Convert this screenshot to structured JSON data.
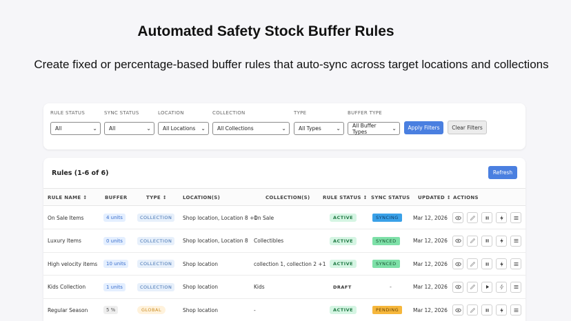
{
  "hero": {
    "title": "Automated Safety Stock Buffer Rules",
    "subtitle": "Create fixed or percentage-based buffer rules that auto-sync across target locations and collections"
  },
  "filters": {
    "rule_status": {
      "label": "RULE STATUS",
      "value": "All"
    },
    "sync_status": {
      "label": "SYNC STATUS",
      "value": "All"
    },
    "location": {
      "label": "LOCATION",
      "value": "All Locations"
    },
    "collection": {
      "label": "COLLECTION",
      "value": "All Collections"
    },
    "type": {
      "label": "TYPE",
      "value": "All Types"
    },
    "buffer_type": {
      "label": "BUFFER TYPE",
      "value": "All Buffer Types"
    },
    "apply_label": "Apply Filters",
    "clear_label": "Clear Filters"
  },
  "rules": {
    "title": "Rules (1-6 of 6)",
    "refresh_label": "Refresh",
    "columns": {
      "rule_name": "RULE NAME ↕",
      "buffer": "BUFFER",
      "type": "TYPE ↕",
      "locations": "LOCATION(S)",
      "collections": "COLLECTION(S)",
      "rule_status": "RULE STATUS ↕",
      "sync_status": "SYNC STATUS",
      "updated": "UPDATED ↕",
      "actions": "ACTIONS"
    },
    "rows": [
      {
        "name": "On Sale Items",
        "buffer": "4 units",
        "type": "COLLECTION",
        "locations": "Shop location, Location 8 +1",
        "collections": "On Sale",
        "status": "ACTIVE",
        "sync": "SYNCING",
        "updated": "Mar 12, 2026"
      },
      {
        "name": "Luxury Items",
        "buffer": "0 units",
        "type": "COLLECTION",
        "locations": "Shop location, Location 8",
        "collections": "Collectibles",
        "status": "ACTIVE",
        "sync": "SYNCED",
        "updated": "Mar 12, 2026"
      },
      {
        "name": "High velocity items",
        "buffer": "10 units",
        "type": "COLLECTION",
        "locations": "Shop location",
        "collections": "collection 1, collection 2 +1",
        "status": "ACTIVE",
        "sync": "SYNCED",
        "updated": "Mar 12, 2026"
      },
      {
        "name": "Kids Collection",
        "buffer": "1 units",
        "type": "COLLECTION",
        "locations": "Shop location",
        "collections": "Kids",
        "status": "DRAFT",
        "sync": "-",
        "updated": "Mar 12, 2026"
      },
      {
        "name": "Regular Season",
        "buffer": "5 %",
        "type": "GLOBAL",
        "locations": "Shop location",
        "collections": "-",
        "status": "ACTIVE",
        "sync": "PENDING",
        "updated": "Mar 12, 2026"
      }
    ]
  },
  "colors": {
    "primary": "#4a7fe0",
    "active": "#d5f5e3",
    "syncing": "#3aa1e8",
    "synced": "#7ee0a8",
    "pending": "#f6b73c"
  }
}
